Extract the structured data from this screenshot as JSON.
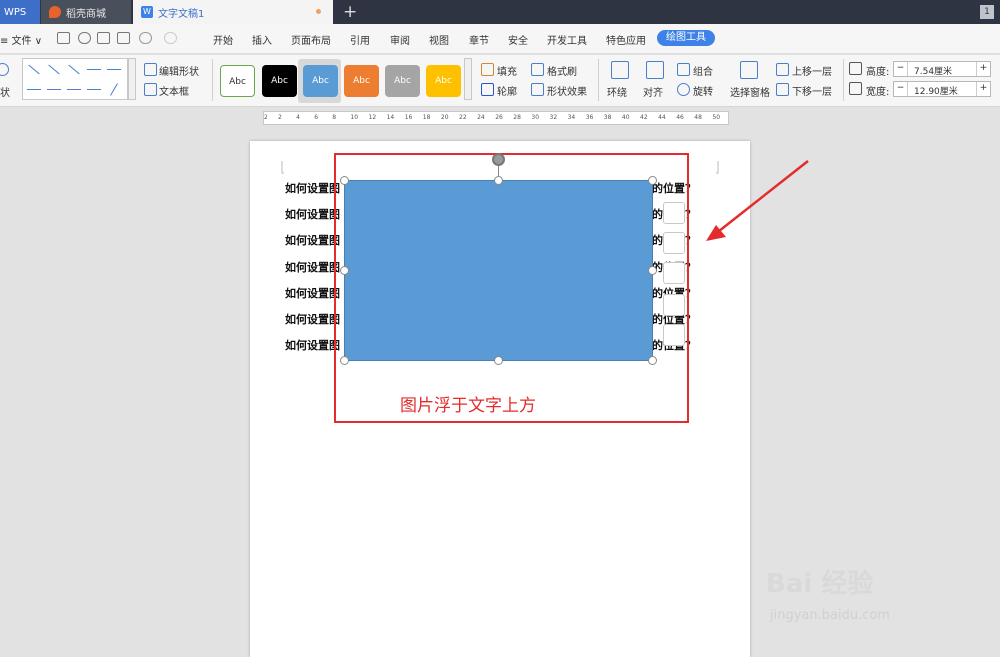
{
  "tabs": {
    "wps": "WPS",
    "daoke": "稻壳商城",
    "doc": "文字文稿1",
    "badge": "1"
  },
  "menubar": {
    "file": "≡ 文件 ∨",
    "items": [
      "开始",
      "插入",
      "页面布局",
      "引用",
      "审阅",
      "视图",
      "章节",
      "安全",
      "开发工具",
      "特色应用"
    ],
    "active": "绘图工具"
  },
  "ribbon": {
    "shape_label": "状",
    "edit_shape": "编辑形状",
    "text_box": "文本框",
    "style_text": "Abc",
    "style_colors": [
      "#ffffff",
      "#000000",
      "#5b9bd5",
      "#ed7d31",
      "#a5a5a5",
      "#ffc000"
    ],
    "fill": "填充",
    "format_painter": "格式刷",
    "outline": "轮廓",
    "shape_effect": "形状效果",
    "wrap": "环绕",
    "align": "对齐",
    "group": "组合",
    "rotate": "旋转",
    "selection_pane": "选择窗格",
    "bring_forward": "上移一层",
    "send_backward": "下移一层",
    "height_label": "高度:",
    "height_value": "7.54厘米",
    "width_label": "宽度:",
    "width_value": "12.90厘米",
    "minus": "−",
    "plus": "+"
  },
  "ruler": {
    "ticks": [
      "2",
      "2",
      "4",
      "6",
      "8",
      "10",
      "12",
      "14",
      "16",
      "18",
      "20",
      "22",
      "24",
      "26",
      "28",
      "30",
      "32",
      "34",
      "36",
      "38",
      "40",
      "42",
      "44",
      "46",
      "48",
      "50"
    ]
  },
  "document": {
    "line_head": "如何设置图",
    "line_tails": [
      "的位置？",
      "的位置？",
      "的位置？",
      "的位置？",
      "的位置？",
      "的位置？",
      "的位置？"
    ],
    "caption": "图片浮于文字上方"
  },
  "watermark": {
    "brand": "Bai 经验",
    "url": "jingyan.baidu.com"
  },
  "colors": {
    "accent": "#3e82e8",
    "highlight": "#e52b2b",
    "shape_fill": "#5b9bd5"
  }
}
